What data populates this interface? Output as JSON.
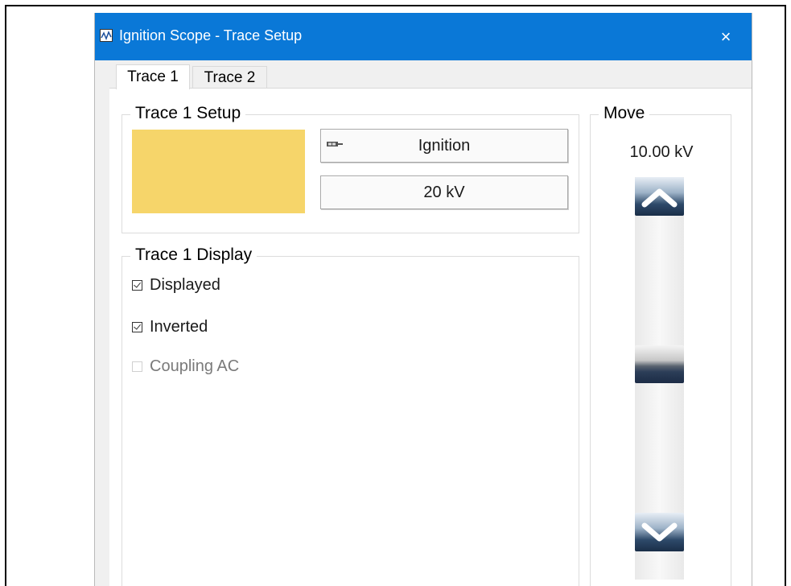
{
  "window": {
    "title": "Ignition Scope - Trace Setup",
    "close_glyph": "×",
    "titlebar_color": "#0a78d7"
  },
  "tabs": [
    {
      "label": "Trace 1",
      "selected": true
    },
    {
      "label": "Trace 2",
      "selected": false
    }
  ],
  "setup": {
    "legend": "Trace 1 Setup",
    "trace_color": "#f6d56a",
    "source": {
      "label": "Ignition",
      "icon": "probe-icon"
    },
    "scale": {
      "label": "20 kV"
    }
  },
  "display": {
    "legend": "Trace 1 Display",
    "options": [
      {
        "label": "Displayed",
        "checked": true,
        "enabled": true
      },
      {
        "label": "Inverted",
        "checked": true,
        "enabled": true
      },
      {
        "label": "Coupling AC",
        "checked": false,
        "enabled": false
      }
    ]
  },
  "move": {
    "legend": "Move",
    "value": "10.00 kV",
    "up_icon": "chevron-up-icon",
    "down_icon": "chevron-down-icon",
    "position_fraction": 0.5
  }
}
